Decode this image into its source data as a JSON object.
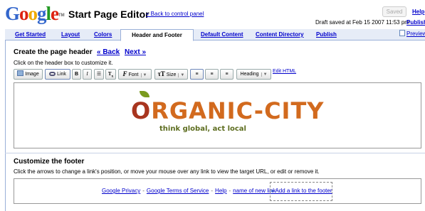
{
  "app": {
    "logo_text": "Google",
    "logo_tm": "TM",
    "title": "Start Page Editor",
    "back_link": "« Back to control panel",
    "saved_button": "Saved",
    "help_link": "Help",
    "draft_status": "Draft saved at Feb 15 2007 11:53 pm",
    "publish_link": "Publish"
  },
  "tabs": [
    {
      "label": "Get Started",
      "active": false
    },
    {
      "label": "Layout",
      "active": false
    },
    {
      "label": "Colors",
      "active": false
    },
    {
      "label": "Header and Footer",
      "active": true
    },
    {
      "label": "Default Content",
      "active": false
    },
    {
      "label": "Content Directory",
      "active": false
    },
    {
      "label": "Publish",
      "active": false
    }
  ],
  "preview_link": "Preview",
  "header_section": {
    "title": "Create the page header",
    "back": "« Back",
    "next": "Next »",
    "hint": "Click on the header box to customize it."
  },
  "toolbar": {
    "image": "Image",
    "link": "Link",
    "bold": "B",
    "italic": "I",
    "font": "Font",
    "size": "Size",
    "heading": "Heading",
    "edit_html": "Edit HTML",
    "dropdown_arrow": "▼"
  },
  "header_image": {
    "brand_first": "O",
    "brand_rest": "RGANIC-CITY",
    "tagline": "think global, act local",
    "colors": {
      "brand": "#d26a1e",
      "tagline": "#5d6d1f",
      "leaf": "#7a9a1e"
    }
  },
  "footer_section": {
    "title": "Customize the footer",
    "hint": "Click the arrows to change a link's position, or move your mouse over any link to view the target URL, or edit or remove it.",
    "links": [
      "Google Privacy",
      "Google Terms of Service",
      "Help",
      "name of new link"
    ],
    "separator": "-",
    "add_link": "Add a link to the footer",
    "add_arrow": "»"
  },
  "colors": {
    "link": "#0000cc",
    "tab_bar": "#e6ecf7",
    "tab_border": "#9ab0d8"
  }
}
